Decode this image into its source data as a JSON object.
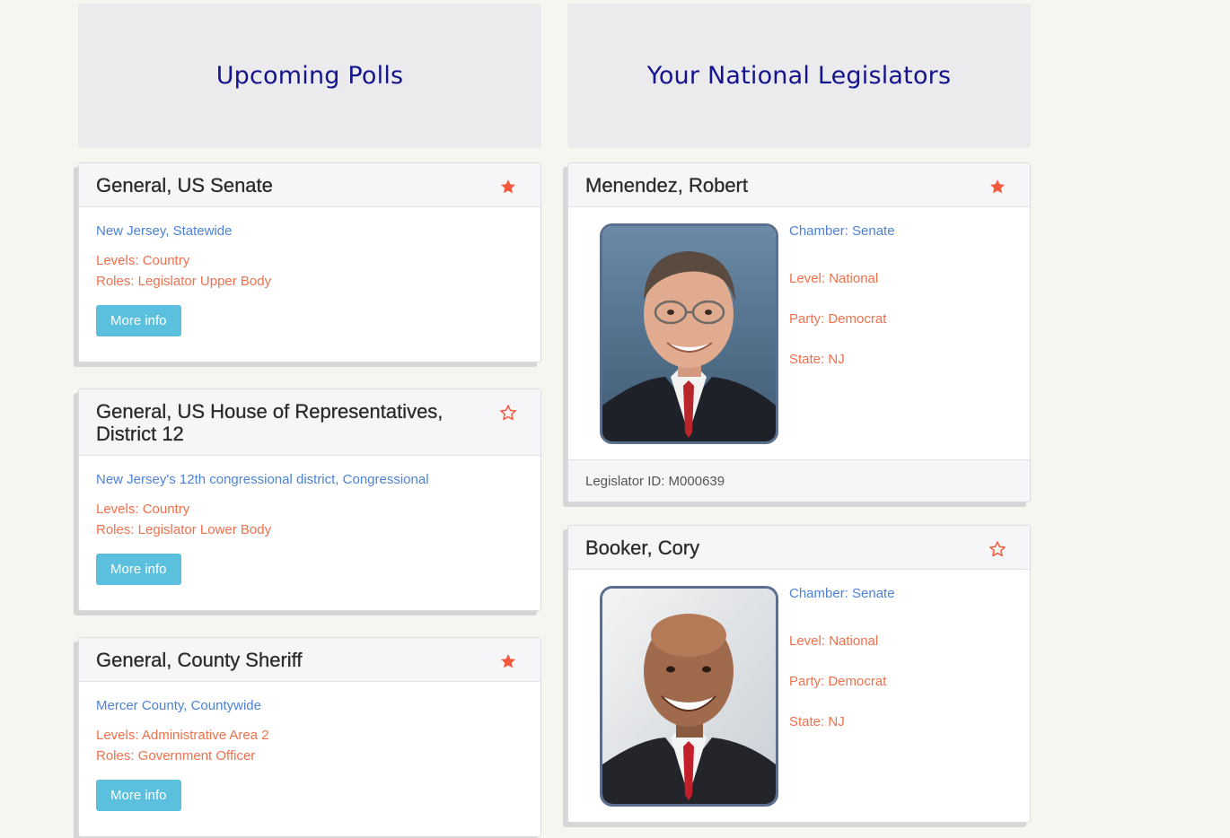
{
  "polls": {
    "heading": "Upcoming Polls",
    "items": [
      {
        "title": "General, US Senate",
        "starred": true,
        "location": "New Jersey, Statewide",
        "levels": "Levels: Country",
        "roles": "Roles: Legislator Upper Body",
        "button": "More info"
      },
      {
        "title": "General, US House of Representatives, District 12",
        "starred": false,
        "location": "New Jersey's 12th congressional district, Congressional",
        "levels": "Levels: Country",
        "roles": "Roles: Legislator Lower Body",
        "button": "More info"
      },
      {
        "title": "General, County Sheriff",
        "starred": true,
        "location": "Mercer County, Countywide",
        "levels": "Levels: Administrative Area 2",
        "roles": "Roles: Government Officer",
        "button": "More info"
      }
    ]
  },
  "legislators": {
    "heading": "Your National Legislators",
    "items": [
      {
        "name": "Menendez, Robert",
        "starred": true,
        "chamber": "Chamber: Senate",
        "level": "Level: National",
        "party": "Party: Democrat",
        "state": "State: NJ",
        "legislator_id": "Legislator ID: M000639"
      },
      {
        "name": "Booker, Cory",
        "starred": false,
        "chamber": "Chamber: Senate",
        "level": "Level: National",
        "party": "Party: Democrat",
        "state": "State: NJ"
      }
    ]
  },
  "colors": {
    "heading": "#14148c",
    "location": "#4d82d6",
    "meta": "#f0704c",
    "button": "#5bc0de",
    "star": "#f5593d"
  },
  "icons": {
    "star_filled": "star-filled-icon",
    "star_outline": "star-outline-icon"
  }
}
